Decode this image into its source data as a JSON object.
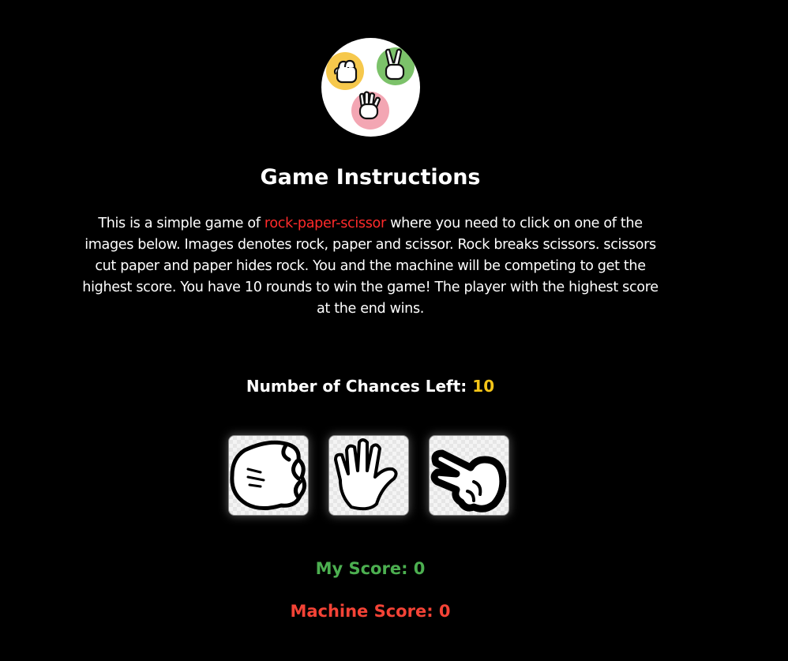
{
  "logo": {
    "icon": "rock-paper-scissors-logo-icon"
  },
  "title": "Game Instructions",
  "instructions": {
    "before": "This is a simple game of ",
    "highlight": "rock-paper-scissor",
    "after": " where you need to click on one of the images below. Images denotes rock, paper and scissor. Rock breaks scissors. scissors cut paper and paper hides rock. You and the machine will be competing to get the highest score. You have 10 rounds to win the game! The player with the highest score at the end wins."
  },
  "chances": {
    "label": "Number of Chances Left: ",
    "value": "10"
  },
  "choices": [
    {
      "icon": "rock-hand-icon"
    },
    {
      "icon": "paper-hand-icon"
    },
    {
      "icon": "scissors-hand-icon"
    }
  ],
  "score": {
    "my_label": "My Score: ",
    "my_value": "0",
    "machine_label": "Machine Score: ",
    "machine_value": "0"
  },
  "colors": {
    "background": "#000000",
    "highlight": "#ff2a2a",
    "chances_value": "#f5c518",
    "my_score": "#4caf50",
    "machine_score": "#f44336"
  }
}
